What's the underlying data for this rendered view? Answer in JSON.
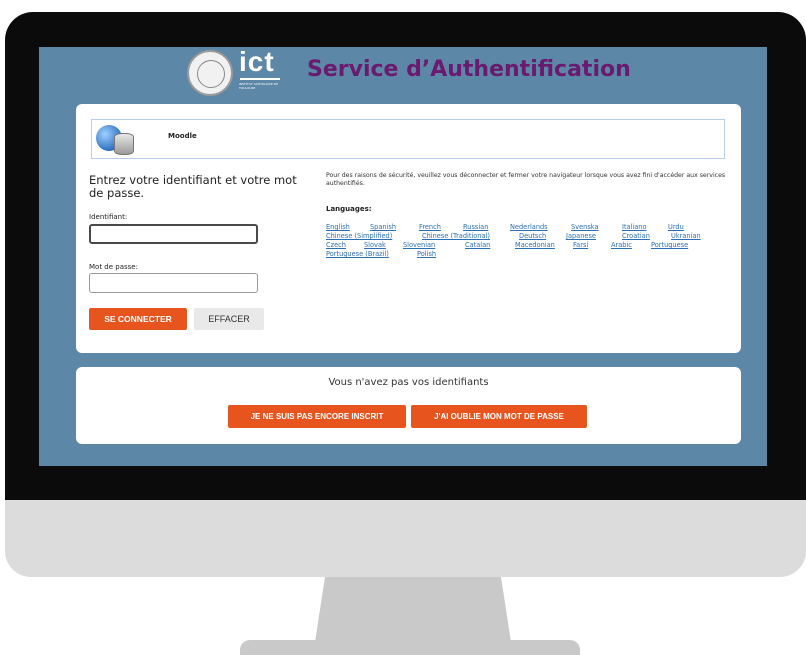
{
  "header": {
    "logo_text": "ict",
    "logo_subtext": "INSTITUT CATHOLIQUE DE TOULOUSE",
    "title": "Service d’Authentification"
  },
  "service": {
    "name": "Moodle"
  },
  "login": {
    "intro": "Entrez votre identifiant et votre mot de passe.",
    "username_label": "Identifiant:",
    "username_value": "",
    "password_label": "Mot de passe:",
    "password_value": "",
    "submit_label": "SE CONNECTER",
    "clear_label": "EFFACER"
  },
  "notice": "Pour des raisons de sécurité, veuillez vous déconnecter et fermer votre navigateur lorsque vous avez fini d'accéder aux services authentifiés.",
  "languages": {
    "heading": "Languages:",
    "rows": [
      [
        "English",
        "Spanish",
        "French",
        "Russian",
        "Nederlands",
        "Svenska",
        "Italiano",
        "Urdu"
      ],
      [
        "Chinese (Simplified)",
        "Chinese (Traditional)",
        "Deutsch",
        "Japanese",
        "Croatian",
        "Ukranian"
      ],
      [
        "Czech",
        "Slovak",
        "Slovenian",
        "Catalan",
        "Macedonian",
        "Farsi",
        "Arabic",
        "Portuguese"
      ],
      [
        "Portuguese (Brazil)",
        "Polish"
      ]
    ]
  },
  "no_credentials": {
    "text": "Vous n'avez pas vos identifiants",
    "not_registered_label": "JE NE SUIS PAS ENCORE INSCRIT",
    "forgot_password_label": "J'AI OUBLIE MON MOT DE PASSE"
  },
  "colors": {
    "screen_bg": "#5d87a7",
    "title": "#6a1a6f",
    "accent": "#e8541e",
    "link": "#2a6fb5"
  }
}
